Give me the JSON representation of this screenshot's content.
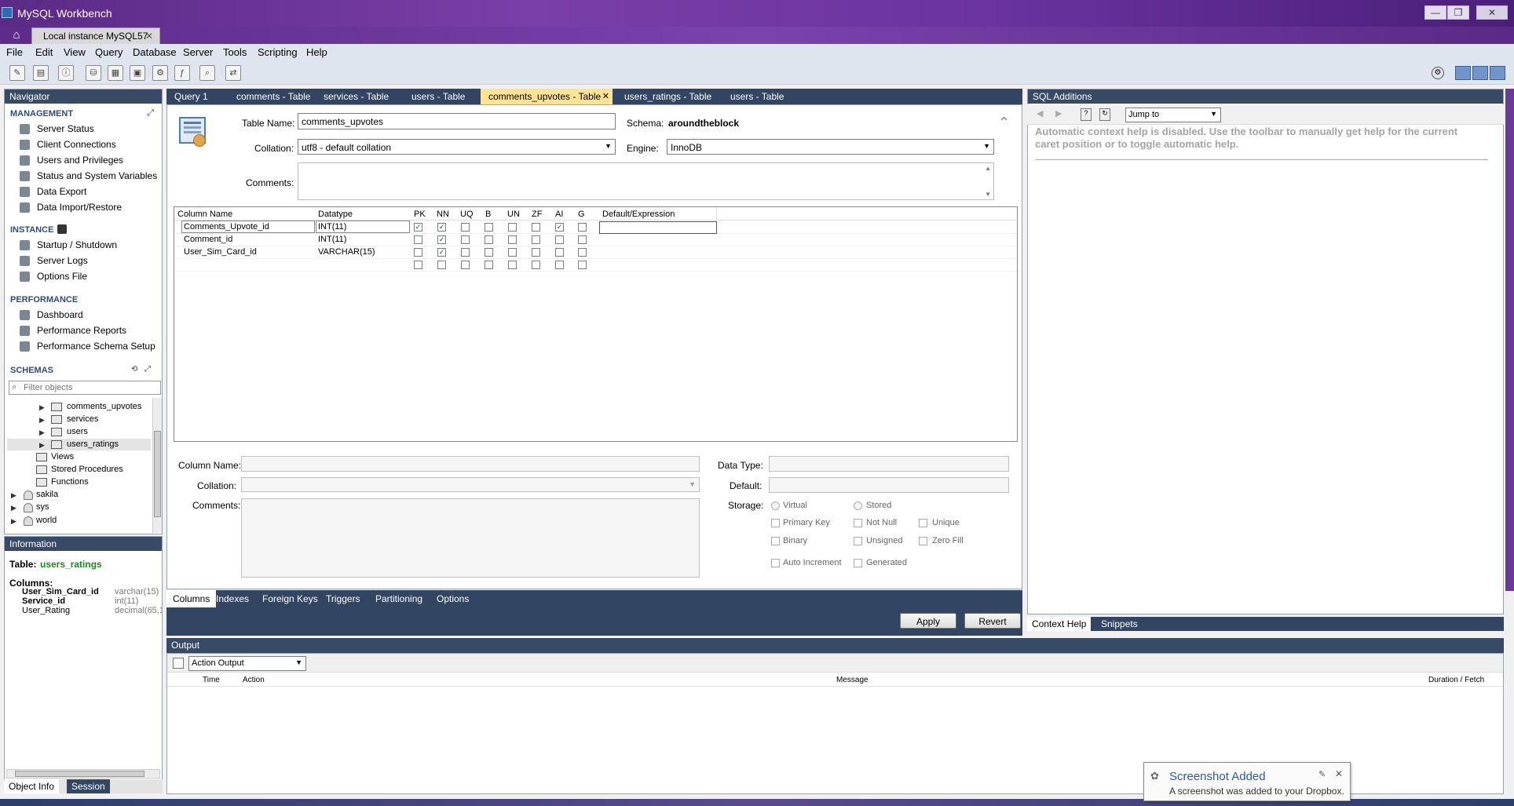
{
  "window": {
    "title": "MySQL Workbench",
    "minimize": "—",
    "restore": "❐",
    "close": "✕"
  },
  "connection_tab": {
    "label": "Local instance MySQL57",
    "close": "✕"
  },
  "menu": [
    "File",
    "Edit",
    "View",
    "Query",
    "Database",
    "Server",
    "Tools",
    "Scripting",
    "Help"
  ],
  "navigator": {
    "title": "Navigator",
    "management": {
      "header": "MANAGEMENT",
      "items": [
        "Server Status",
        "Client Connections",
        "Users and Privileges",
        "Status and System Variables",
        "Data Export",
        "Data Import/Restore"
      ]
    },
    "instance": {
      "header": "INSTANCE",
      "items": [
        "Startup / Shutdown",
        "Server Logs",
        "Options File"
      ]
    },
    "performance": {
      "header": "PERFORMANCE",
      "items": [
        "Dashboard",
        "Performance Reports",
        "Performance Schema Setup"
      ]
    },
    "schemas": {
      "header": "SCHEMAS",
      "filter_placeholder": "Filter objects",
      "tables": [
        "comments_upvotes",
        "services",
        "users",
        "users_ratings"
      ],
      "schema_children": [
        "Views",
        "Stored Procedures",
        "Functions"
      ],
      "other_schemas": [
        "sakila",
        "sys",
        "world"
      ]
    }
  },
  "information": {
    "title": "Information",
    "table_label": "Table:",
    "table_name": "users_ratings",
    "columns_label": "Columns:",
    "columns": [
      {
        "name": "User_Sim_Card_id",
        "type": "varchar(15)"
      },
      {
        "name": "Service_id",
        "type": "int(11)"
      },
      {
        "name": "User_Rating",
        "type": "decimal(65,1"
      }
    ]
  },
  "nav_tabs": [
    "Object Info",
    "Session"
  ],
  "editor_tabs": [
    {
      "label": "Query 1",
      "active": false
    },
    {
      "label": "comments - Table",
      "active": false
    },
    {
      "label": "services - Table",
      "active": false
    },
    {
      "label": "users - Table",
      "active": false
    },
    {
      "label": "comments_upvotes - Table",
      "active": true
    },
    {
      "label": "users_ratings - Table",
      "active": false
    },
    {
      "label": "users - Table",
      "active": false
    }
  ],
  "editor_tab_close": "✕",
  "table_editor": {
    "table_name_label": "Table Name:",
    "table_name": "comments_upvotes",
    "schema_label": "Schema:",
    "schema": "aroundtheblock",
    "collation_label": "Collation:",
    "collation": "utf8 - default collation",
    "engine_label": "Engine:",
    "engine": "InnoDB",
    "comments_label": "Comments:"
  },
  "grid": {
    "headers": [
      "Column Name",
      "Datatype",
      "PK",
      "NN",
      "UQ",
      "B",
      "UN",
      "ZF",
      "AI",
      "G",
      "Default/Expression"
    ],
    "rows": [
      {
        "name": "Comments_Upvote_id",
        "type": "INT(11)",
        "flags": [
          true,
          true,
          false,
          false,
          false,
          false,
          true,
          false
        ]
      },
      {
        "name": "Comment_id",
        "type": "INT(11)",
        "flags": [
          false,
          true,
          false,
          false,
          false,
          false,
          false,
          false
        ]
      },
      {
        "name": "User_Sim_Card_id",
        "type": "VARCHAR(15)",
        "flags": [
          false,
          true,
          false,
          false,
          false,
          false,
          false,
          false
        ]
      },
      {
        "name": "",
        "type": "",
        "flags": [
          false,
          false,
          false,
          false,
          false,
          false,
          false,
          false
        ]
      }
    ]
  },
  "column_detail": {
    "column_name_label": "Column Name:",
    "data_type_label": "Data Type:",
    "collation_label": "Collation:",
    "default_label": "Default:",
    "comments_label": "Comments:",
    "storage_label": "Storage:",
    "virtual": "Virtual",
    "stored": "Stored",
    "primary_key": "Primary Key",
    "not_null": "Not Null",
    "unique": "Unique",
    "binary": "Binary",
    "unsigned": "Unsigned",
    "zero_fill": "Zero Fill",
    "auto_increment": "Auto Increment",
    "generated": "Generated"
  },
  "bottom_tabs": [
    "Columns",
    "Indexes",
    "Foreign Keys",
    "Triggers",
    "Partitioning",
    "Options"
  ],
  "buttons": {
    "apply": "Apply",
    "revert": "Revert"
  },
  "sql_additions": {
    "title": "SQL Additions",
    "jump_to": "Jump to",
    "help_text": "Automatic context help is disabled. Use the toolbar to manually get help for the current caret position or to toggle automatic help.",
    "tabs": [
      "Context Help",
      "Snippets"
    ]
  },
  "output": {
    "title": "Output",
    "selector": "Action Output",
    "columns": [
      "Time",
      "Action",
      "Message",
      "Duration / Fetch"
    ]
  },
  "toast": {
    "title": "Screenshot Added",
    "message": "A screenshot was added to your Dropbox.",
    "close": "✕"
  }
}
